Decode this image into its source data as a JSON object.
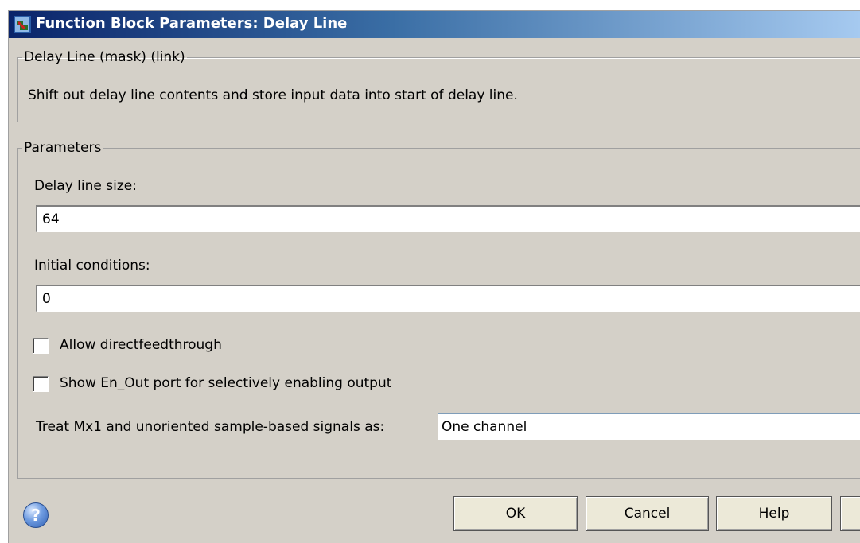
{
  "window": {
    "title": "Function Block Parameters: Delay Line"
  },
  "mask_group": {
    "legend": "Delay Line (mask) (link)",
    "description": "Shift out delay line contents and store input data into start of delay line."
  },
  "parameters": {
    "legend": "Parameters",
    "delay_line_size": {
      "label": "Delay line size:",
      "value": "64"
    },
    "initial_conditions": {
      "label": "Initial conditions:",
      "value": "0"
    },
    "allow_direct_feedthrough": {
      "label": "Allow directfeedthrough",
      "checked": false
    },
    "show_en_out": {
      "label": "Show En_Out port for selectively enabling output",
      "checked": false
    },
    "treat_mx1": {
      "label": "Treat Mx1 and unoriented sample-based signals as:",
      "value": "One channel"
    }
  },
  "buttons": {
    "ok": "OK",
    "cancel": "Cancel",
    "help": "Help"
  },
  "icons": {
    "title_icon": "simulink-block-icon",
    "help_icon": "question-circle-icon"
  }
}
